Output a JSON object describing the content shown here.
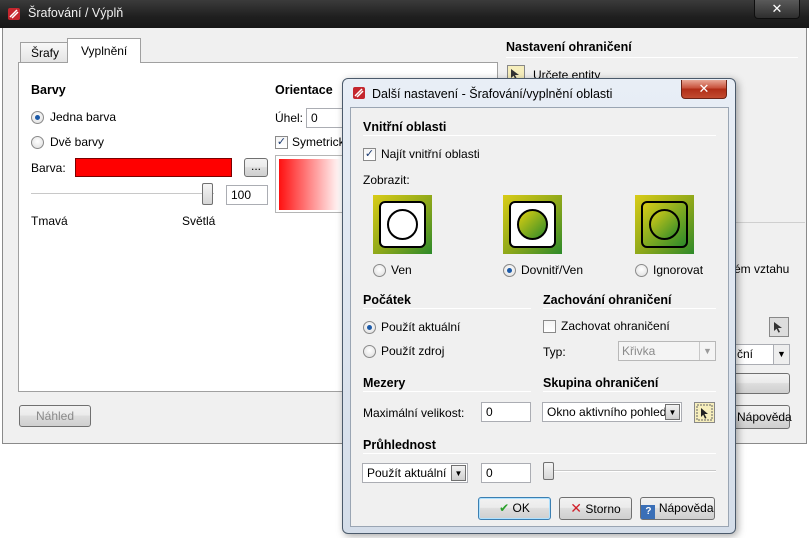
{
  "main_window": {
    "title": "Šrafování / Výplň",
    "close_label": "✕",
    "tabs": [
      {
        "label": "Šrafy"
      },
      {
        "label": "Vyplnění"
      }
    ],
    "colors_section": {
      "title": "Barvy",
      "single_color_label": "Jedna barva",
      "two_colors_label": "Dvě barvy",
      "color_label": "Barva:",
      "color_value": "#ff0000",
      "browse_label": "...",
      "shade_value": "100",
      "shade_level_percent": 100,
      "dark_label": "Tmavá",
      "light_label": "Světlá"
    },
    "orientation_section": {
      "title": "Orientace",
      "angle_label": "Úhel:",
      "angle_value": "0",
      "symmetric_label": "Symetrický"
    },
    "boundary_section": {
      "title": "Nastavení ohraničení",
      "pick_entities_label": "Určete entity",
      "relation_fragment": "ém vztahu",
      "combo_fragment": "ční"
    },
    "preview_label": "Náhled",
    "help_label": "Nápověda"
  },
  "dialog": {
    "title": "Další nastavení -  Šrafování/vyplnění oblasti",
    "close_label": "✕",
    "inner_areas": {
      "title": "Vnitřní oblasti",
      "find_label": "Najít vnitřní oblasti",
      "display_label": "Zobrazit:",
      "options": [
        {
          "label": "Ven"
        },
        {
          "label": "Dovnitř/Ven"
        },
        {
          "label": "Ignorovat"
        }
      ]
    },
    "origin": {
      "title": "Počátek",
      "use_current_label": "Použít aktuální",
      "use_source_label": "Použít zdroj"
    },
    "retain_boundary": {
      "title": "Zachování ohraničení",
      "retain_label": "Zachovat ohraničení",
      "type_label": "Typ:",
      "type_value": "Křivka"
    },
    "gaps": {
      "title": "Mezery",
      "max_size_label": "Maximální velikost:",
      "max_size_value": "0"
    },
    "boundary_set": {
      "title": "Skupina ohraničení",
      "value": "Okno aktivního pohledu"
    },
    "transparency": {
      "title": "Průhlednost",
      "mode_value": "Použít aktuální",
      "value": "0",
      "level_percent": 0
    },
    "ok_label": "OK",
    "cancel_label": "Storno",
    "help_label": "Nápověda"
  },
  "colors": {
    "accent_blue": "#1c5aa8",
    "fill_red": "#ff0000",
    "titlebar_dark": "#1f1f1f"
  }
}
